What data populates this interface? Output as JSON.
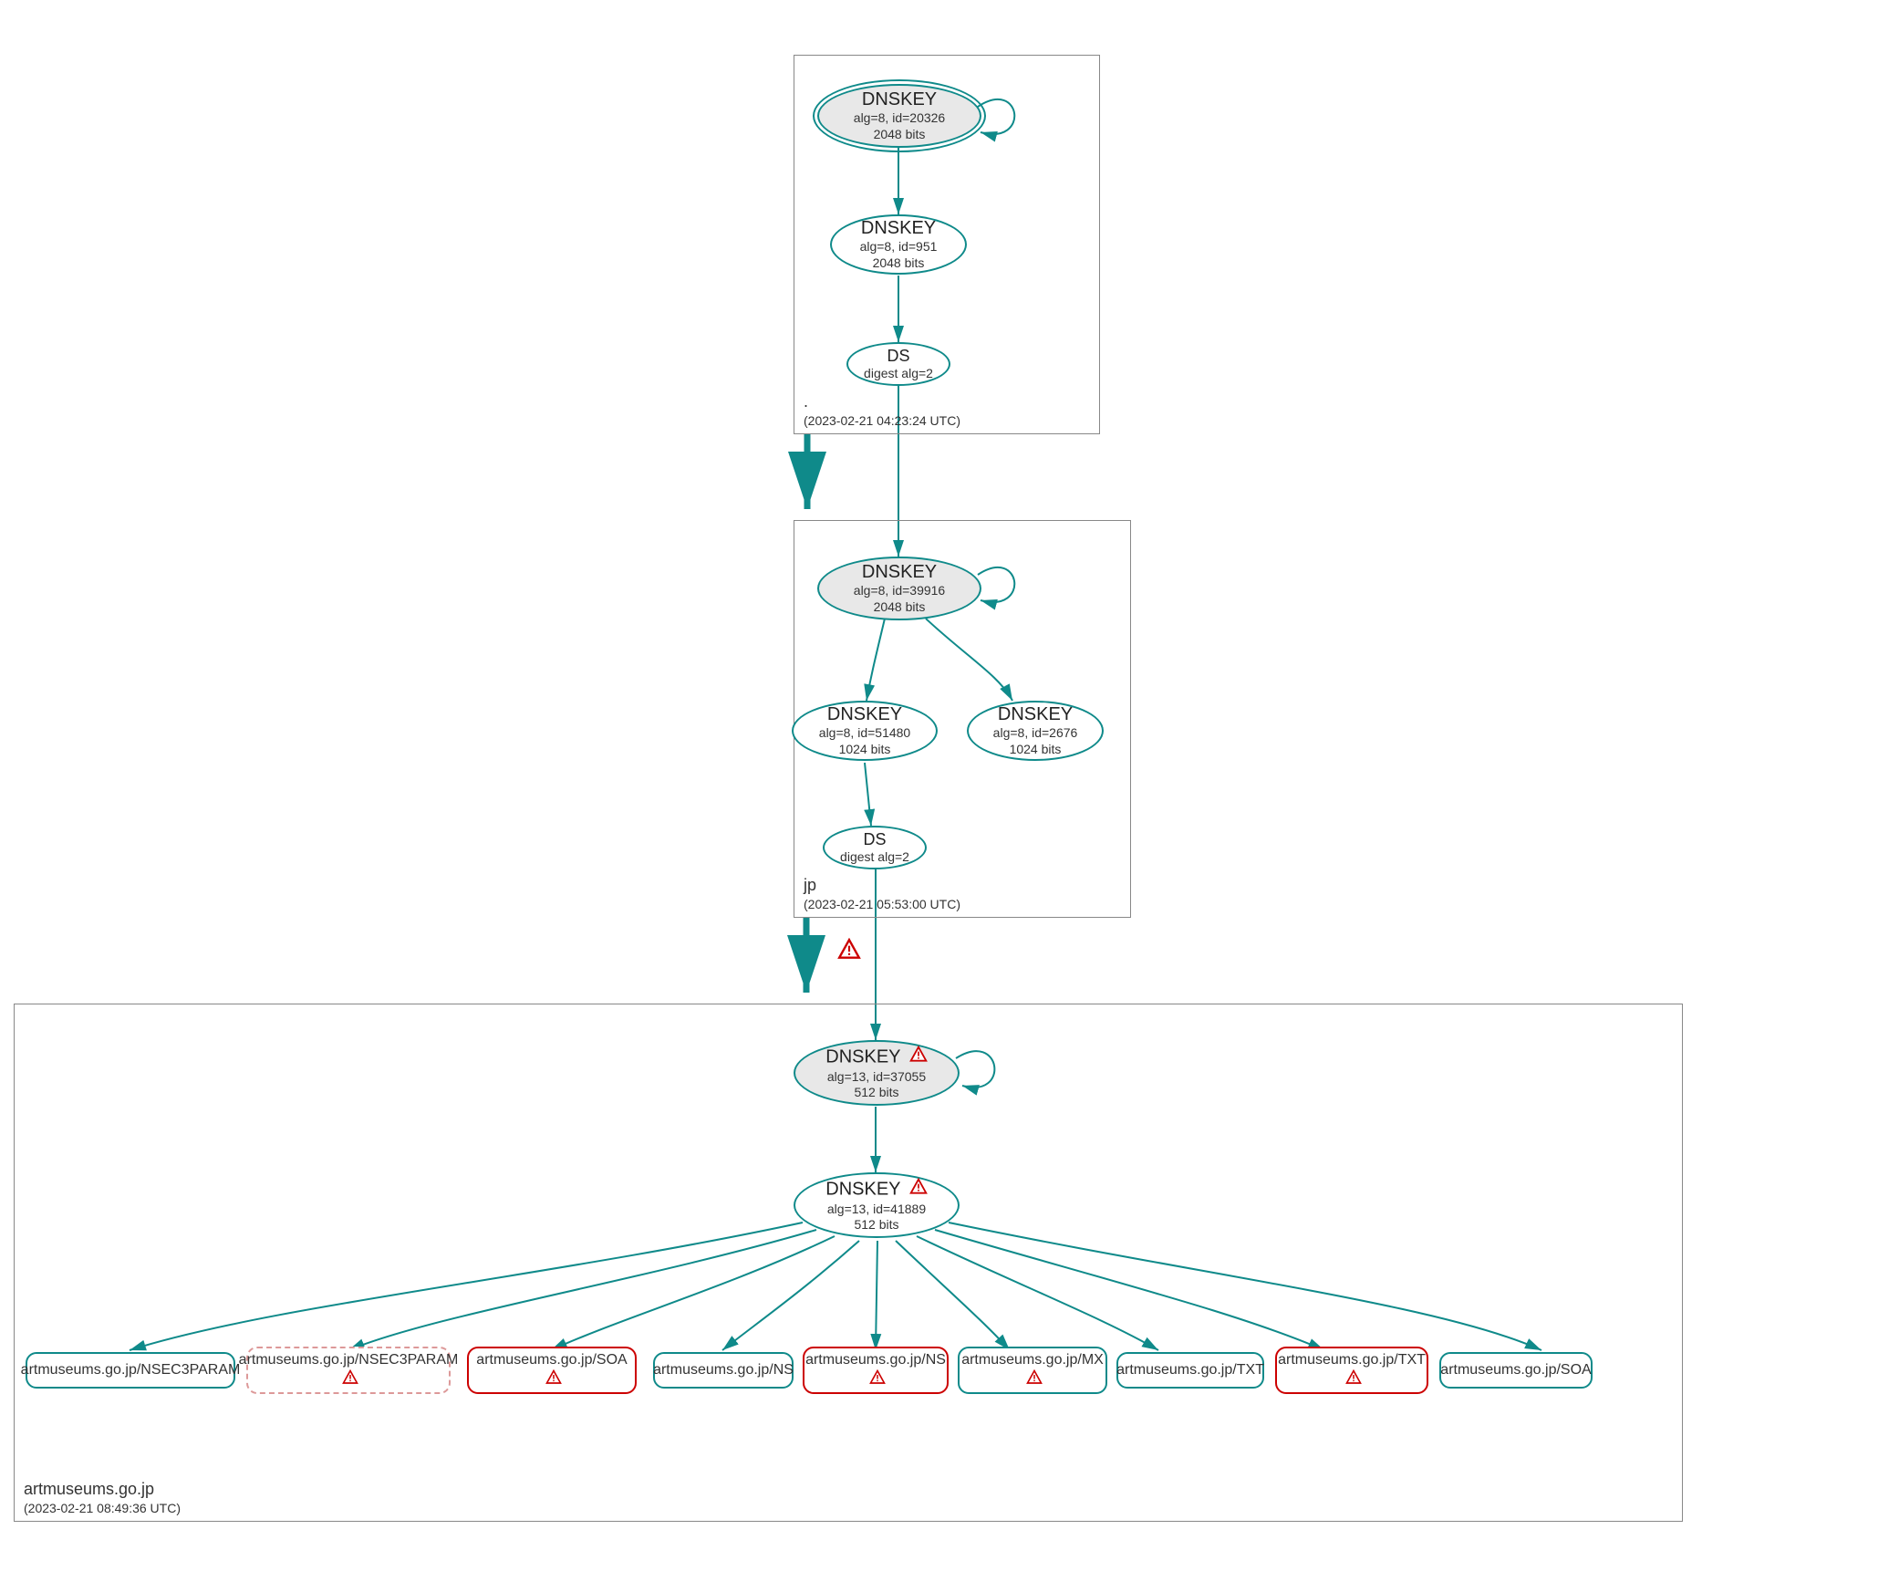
{
  "icons": {
    "warning": "warning-triangle-icon"
  },
  "colors": {
    "teal": "#0f8a8a",
    "red": "#cc0000",
    "grayFill": "#e8e8e8"
  },
  "zones": {
    "root": {
      "name": ".",
      "timestamp": "(2023-02-21 04:23:24 UTC)"
    },
    "jp": {
      "name": "jp",
      "timestamp": "(2023-02-21 05:53:00 UTC)"
    },
    "artmuseums": {
      "name": "artmuseums.go.jp",
      "timestamp": "(2023-02-21 08:49:36 UTC)"
    }
  },
  "nodes": {
    "root_ksk": {
      "title": "DNSKEY",
      "line1": "alg=8, id=20326",
      "line2": "2048 bits"
    },
    "root_zsk": {
      "title": "DNSKEY",
      "line1": "alg=8, id=951",
      "line2": "2048 bits"
    },
    "root_ds": {
      "title": "DS",
      "line1": "digest alg=2"
    },
    "jp_ksk": {
      "title": "DNSKEY",
      "line1": "alg=8, id=39916",
      "line2": "2048 bits"
    },
    "jp_zsk1": {
      "title": "DNSKEY",
      "line1": "alg=8, id=51480",
      "line2": "1024 bits"
    },
    "jp_zsk2": {
      "title": "DNSKEY",
      "line1": "alg=8, id=2676",
      "line2": "1024 bits"
    },
    "jp_ds": {
      "title": "DS",
      "line1": "digest alg=2"
    },
    "am_ksk": {
      "title": "DNSKEY",
      "line1": "alg=13, id=37055",
      "line2": "512 bits",
      "warn": true
    },
    "am_zsk": {
      "title": "DNSKEY",
      "line1": "alg=13, id=41889",
      "line2": "512 bits",
      "warn": true
    },
    "rr1": {
      "label": "artmuseums.go.jp/NSEC3PARAM"
    },
    "rr2": {
      "label": "artmuseums.go.jp/NSEC3PARAM",
      "warn": true
    },
    "rr3": {
      "label": "artmuseums.go.jp/SOA",
      "warn": true
    },
    "rr4": {
      "label": "artmuseums.go.jp/NS"
    },
    "rr5": {
      "label": "artmuseums.go.jp/NS",
      "warn": true
    },
    "rr6": {
      "label": "artmuseums.go.jp/MX",
      "warn": true
    },
    "rr7": {
      "label": "artmuseums.go.jp/TXT"
    },
    "rr8": {
      "label": "artmuseums.go.jp/TXT",
      "warn": true
    },
    "rr9": {
      "label": "artmuseums.go.jp/SOA"
    }
  }
}
